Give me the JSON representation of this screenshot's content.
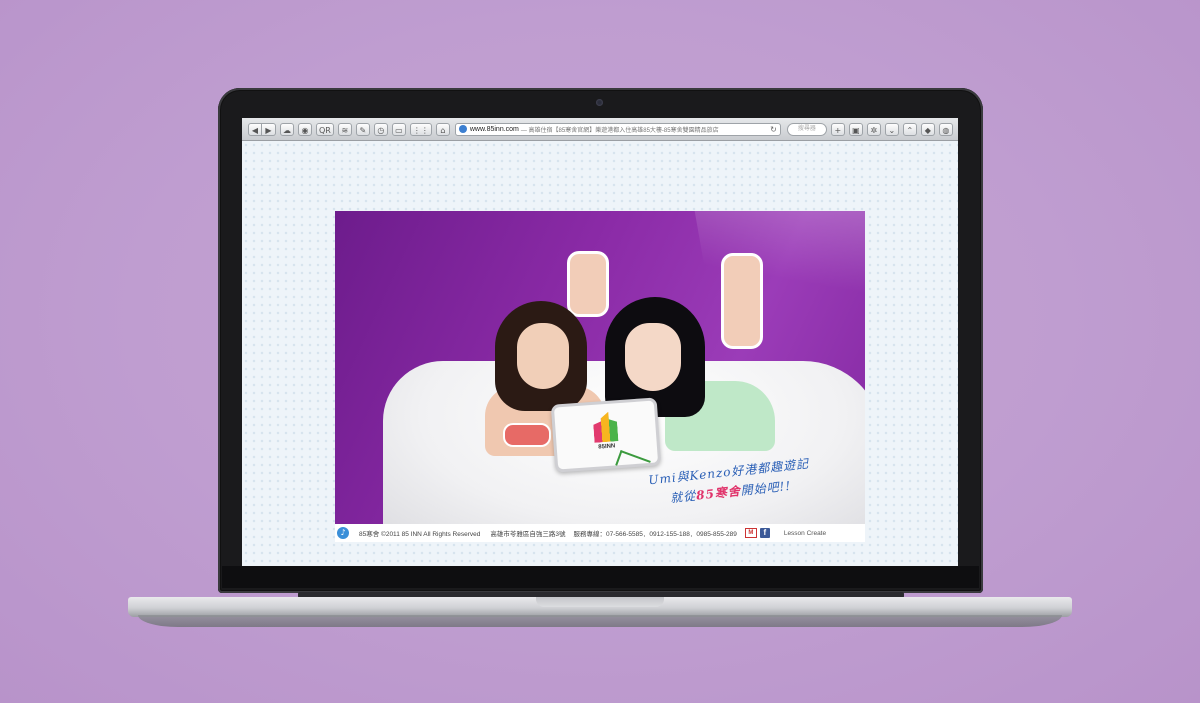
{
  "browser": {
    "url_domain": "www.85inn.com",
    "url_title": "— 高雄住宿【85寒舍官網】樂遊港都入住高雄85大樓-85寒舍雙園精品旅店",
    "reload_icon": "reload-icon",
    "search_placeholder": "搜尋器"
  },
  "hero": {
    "tablet_brand": "85INN",
    "speech_line1": "Umi與Kenzo好港都趣遊記",
    "speech_line2_prefix": "就從",
    "speech_line2_highlight": "85寒舍",
    "speech_line2_suffix": "開始吧!!"
  },
  "footer": {
    "copyright": "85寒舍 ©2011 85 INN All Rights Reserved",
    "address": "高雄市苓雅區自強三路3號",
    "phone": "服務專線：07-566-5585．0912-155-188．0985-855-289",
    "credit": "Lesson Create"
  },
  "colors": {
    "background": "#c39fd3",
    "hero_purple": "#8a2aa6",
    "speech_blue": "#2a5fb6",
    "highlight_pink": "#e0326a"
  }
}
